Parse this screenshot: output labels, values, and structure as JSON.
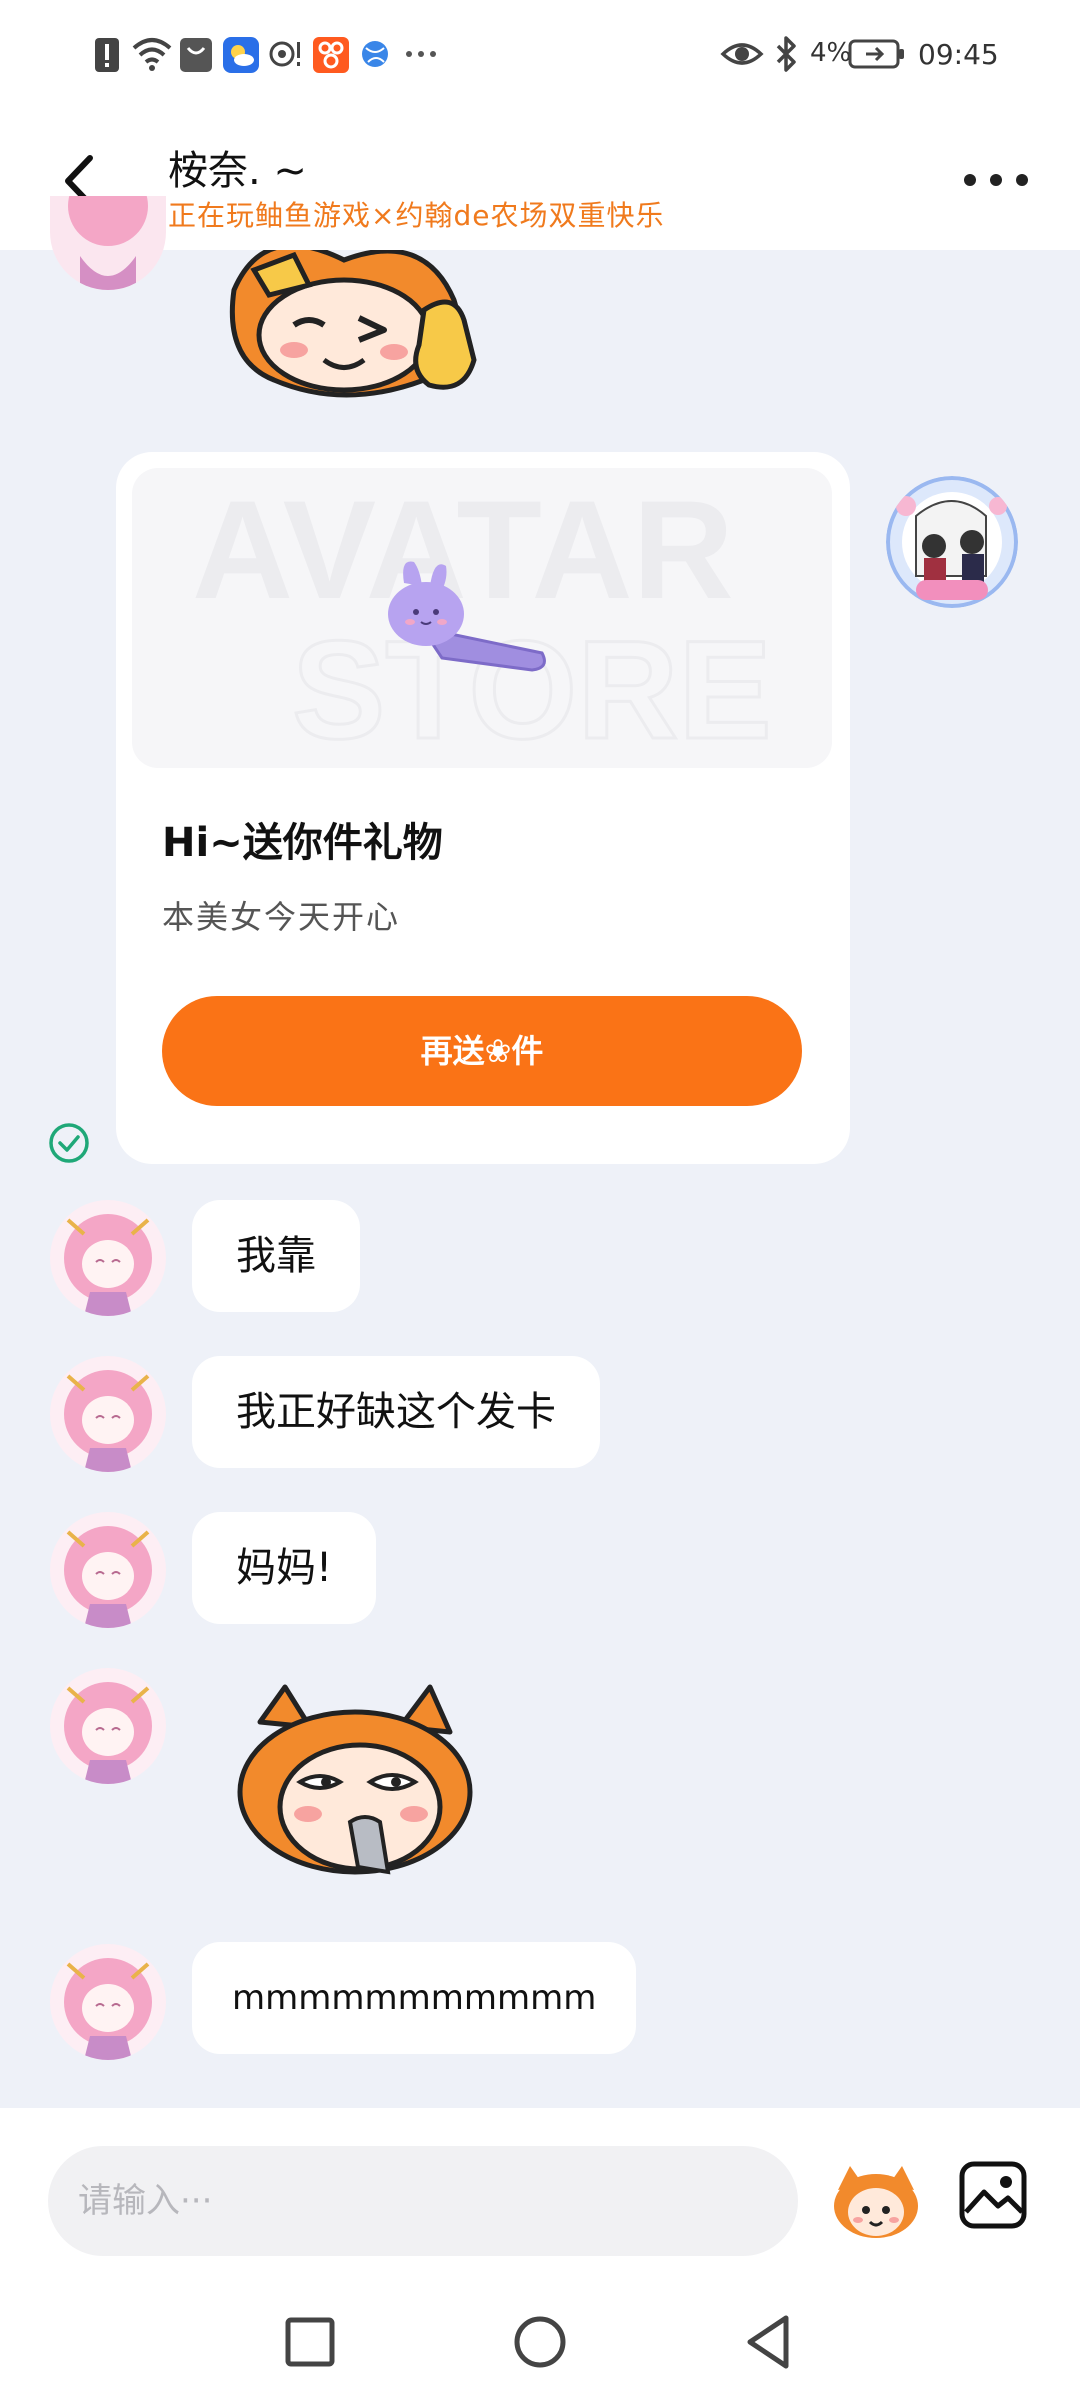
{
  "status_bar": {
    "battery": "4%",
    "time": "09:45",
    "icons": [
      "alert-icon",
      "wifi-icon",
      "shopping-bag-icon",
      "weather-icon",
      "nfc-icon",
      "app-icon",
      "globe-icon",
      "more-notifications-icon",
      "eye-icon",
      "bluetooth-icon",
      "battery-icon"
    ],
    "more": "···"
  },
  "header": {
    "title": "桉奈. ~",
    "status": "正在玩鲉鱼游戏×约翰de农场双重快乐"
  },
  "gift_card": {
    "image_text_line1": "AVATAR",
    "image_text_line2": "STORE",
    "title": "Hi~送你件礼物",
    "description": "本美女今天开心",
    "button_label": "再送❀件"
  },
  "messages": [
    {
      "text": "我靠"
    },
    {
      "text": "我正好缺这个发卡"
    },
    {
      "text": "妈妈!"
    },
    {
      "text": "mmmmmmmmmmm"
    }
  ],
  "sticker_names": [
    "wink-thumbs-up-sticker",
    "eating-sticker"
  ],
  "input": {
    "placeholder": "请输入···"
  },
  "colors": {
    "accent": "#fa7316",
    "status_text": "#f07a1d",
    "chat_background": "#eef1f8",
    "bubble": "#ffffff",
    "read_check": "#1fa878"
  }
}
